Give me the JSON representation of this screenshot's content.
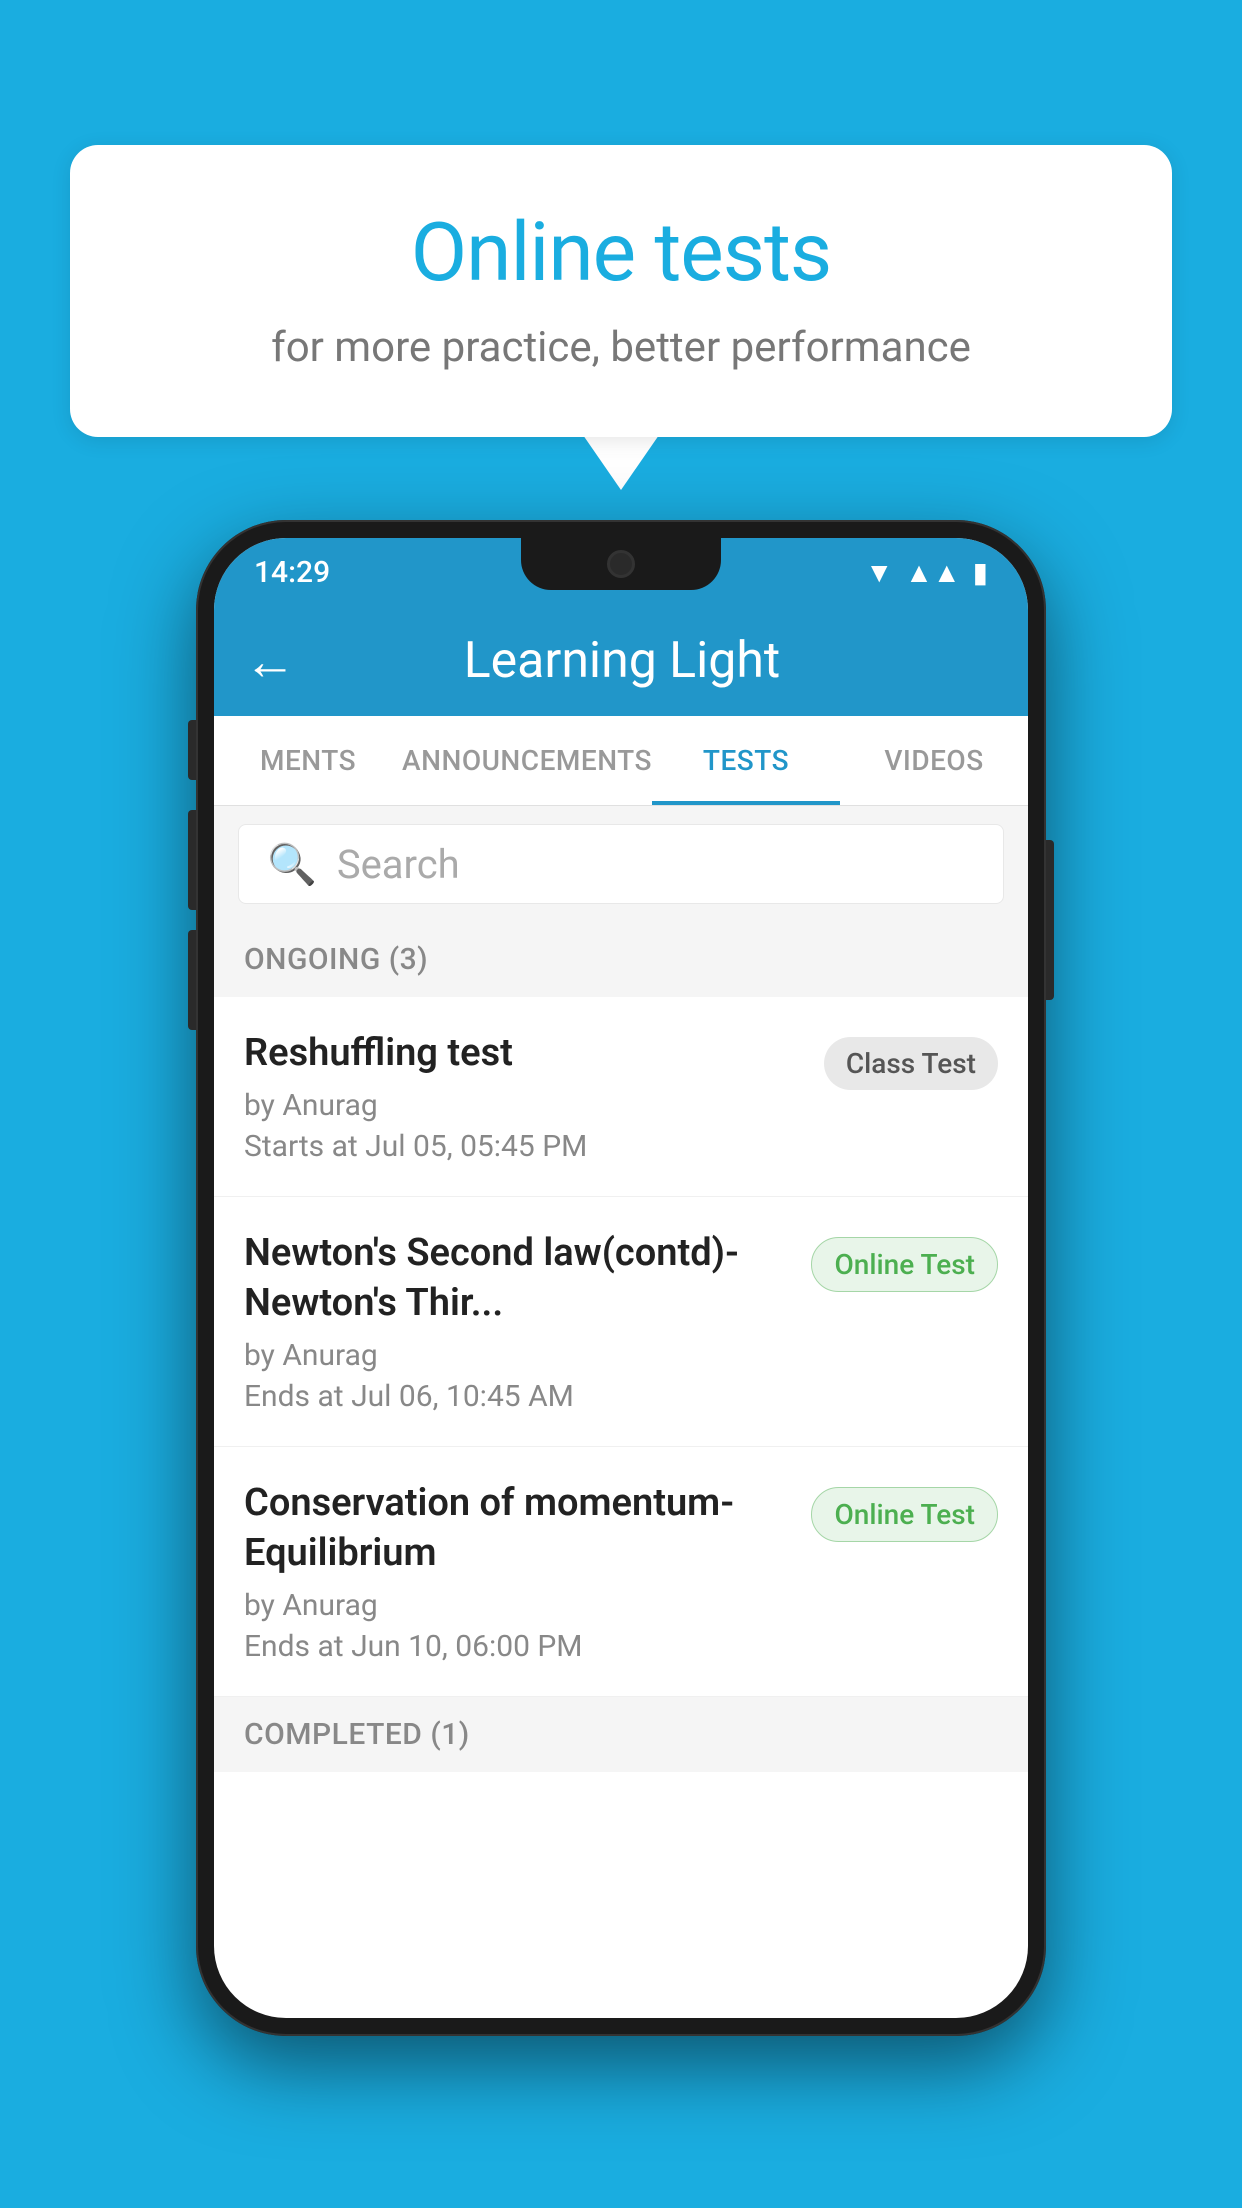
{
  "background_color": "#1AADE0",
  "speech_bubble": {
    "title": "Online tests",
    "subtitle": "for more practice, better performance"
  },
  "phone": {
    "status_bar": {
      "time": "14:29",
      "wifi_icon": "wifi",
      "signal_icon": "signal",
      "battery_icon": "battery"
    },
    "app_header": {
      "back_label": "←",
      "title": "Learning Light"
    },
    "tabs": [
      {
        "label": "MENTS",
        "active": false
      },
      {
        "label": "ANNOUNCEMENTS",
        "active": false
      },
      {
        "label": "TESTS",
        "active": true
      },
      {
        "label": "VIDEOS",
        "active": false
      }
    ],
    "search": {
      "placeholder": "Search"
    },
    "ongoing_section": {
      "label": "ONGOING (3)"
    },
    "tests": [
      {
        "name": "Reshuffling test",
        "by": "by Anurag",
        "time_label": "Starts at",
        "time_value": "Jul 05, 05:45 PM",
        "badge": "Class Test",
        "badge_type": "class"
      },
      {
        "name": "Newton's Second law(contd)-Newton's Thir...",
        "by": "by Anurag",
        "time_label": "Ends at",
        "time_value": "Jul 06, 10:45 AM",
        "badge": "Online Test",
        "badge_type": "online"
      },
      {
        "name": "Conservation of momentum-Equilibrium",
        "by": "by Anurag",
        "time_label": "Ends at",
        "time_value": "Jun 10, 06:00 PM",
        "badge": "Online Test",
        "badge_type": "online"
      }
    ],
    "completed_section": {
      "label": "COMPLETED (1)"
    }
  }
}
